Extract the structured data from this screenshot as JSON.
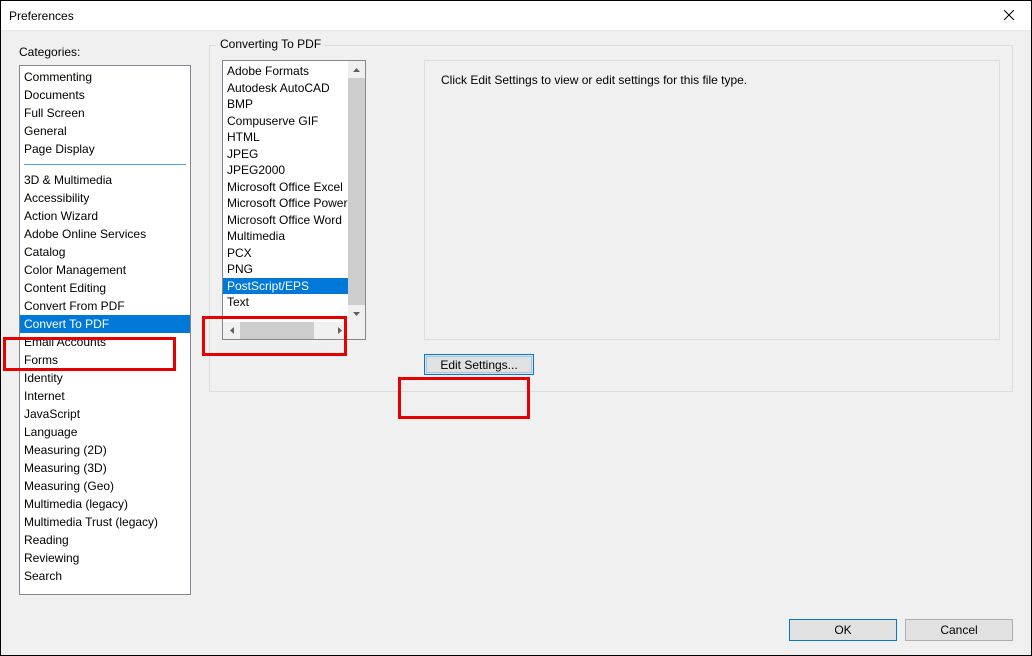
{
  "window": {
    "title": "Preferences"
  },
  "left": {
    "label": "Categories:",
    "group1": [
      "Commenting",
      "Documents",
      "Full Screen",
      "General",
      "Page Display"
    ],
    "group2": [
      "3D & Multimedia",
      "Accessibility",
      "Action Wizard",
      "Adobe Online Services",
      "Catalog",
      "Color Management",
      "Content Editing",
      "Convert From PDF",
      "Convert To PDF",
      "Email Accounts",
      "Forms",
      "Identity",
      "Internet",
      "JavaScript",
      "Language",
      "Measuring (2D)",
      "Measuring (3D)",
      "Measuring (Geo)",
      "Multimedia (legacy)",
      "Multimedia Trust (legacy)",
      "Reading",
      "Reviewing",
      "Search"
    ],
    "selected": "Convert To PDF"
  },
  "right": {
    "group_label": "Converting To PDF",
    "formats": [
      "Adobe Formats",
      "Autodesk AutoCAD",
      "BMP",
      "Compuserve GIF",
      "HTML",
      "JPEG",
      "JPEG2000",
      "Microsoft Office Excel",
      "Microsoft Office PowerPoint",
      "Microsoft Office Word",
      "Multimedia",
      "PCX",
      "PNG",
      "PostScript/EPS",
      "Text"
    ],
    "selected_format": "PostScript/EPS",
    "hint": "Click Edit Settings to view or edit settings for this file type.",
    "edit_button": "Edit Settings..."
  },
  "buttons": {
    "ok": "OK",
    "cancel": "Cancel"
  }
}
